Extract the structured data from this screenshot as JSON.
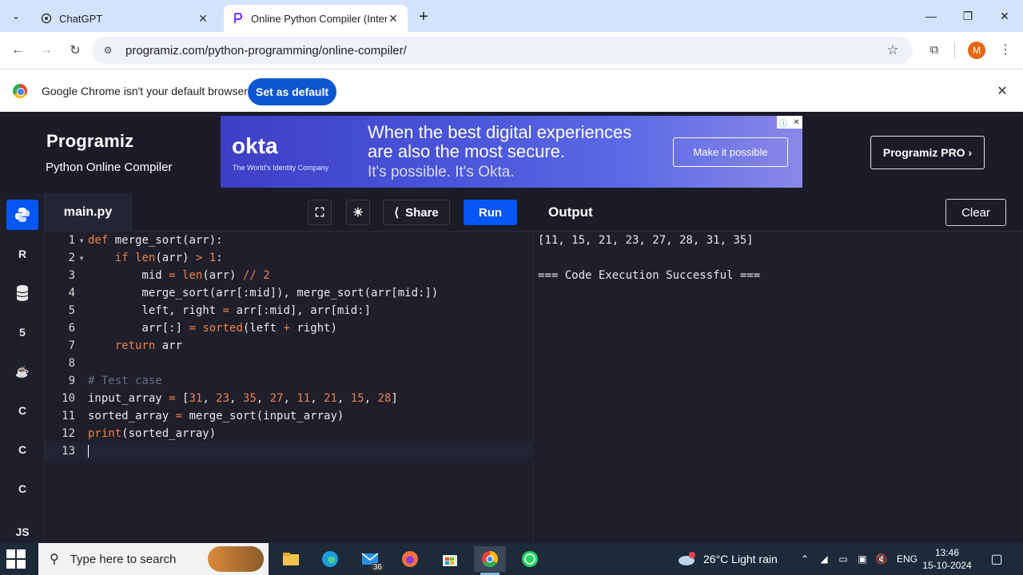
{
  "browser": {
    "tabs": [
      {
        "title": "ChatGPT",
        "icon": "chatgpt-icon"
      },
      {
        "title": "Online Python Compiler (Interp",
        "icon": "programiz-icon",
        "active": true
      }
    ],
    "url": "programiz.com/python-programming/online-compiler/",
    "profile_initial": "M",
    "infobar": {
      "message": "Google Chrome isn't your default browser",
      "button": "Set as default"
    }
  },
  "header": {
    "logo": "Programiz",
    "subtitle": "Python Online Compiler",
    "pro_button": "Programiz PRO ›",
    "ad": {
      "brand": "okta",
      "brand_tag": "The World's Identity Company",
      "headline_1": "When the best digital experiences",
      "headline_2": "are also the most secure.",
      "tagline": "It's possible. It's Okta.",
      "cta": "Make it possible"
    }
  },
  "languages": [
    "python",
    "r",
    "sql",
    "html",
    "java",
    "c",
    "cpp",
    "csharp",
    "js"
  ],
  "editor": {
    "file_name": "main.py",
    "share_label": "Share",
    "run_label": "Run",
    "line_numbers": [
      "1",
      "2",
      "3",
      "4",
      "5",
      "6",
      "7",
      "8",
      "9",
      "10",
      "11",
      "12",
      "13"
    ]
  },
  "output": {
    "title": "Output",
    "clear_label": "Clear",
    "lines": [
      "[11, 15, 21, 23, 27, 28, 31, 35]",
      "",
      "=== Code Execution Successful ==="
    ]
  },
  "taskbar": {
    "search_placeholder": "Type here to search",
    "mail_badge": "36",
    "weather": "26°C  Light rain",
    "weather_badge": "1",
    "language": "ENG",
    "time": "13:46",
    "date": "15-10-2024"
  },
  "colors": {
    "run_button": "#0556f3",
    "keyword": "#ef8145",
    "editor_bg": "#1e1f2b"
  }
}
